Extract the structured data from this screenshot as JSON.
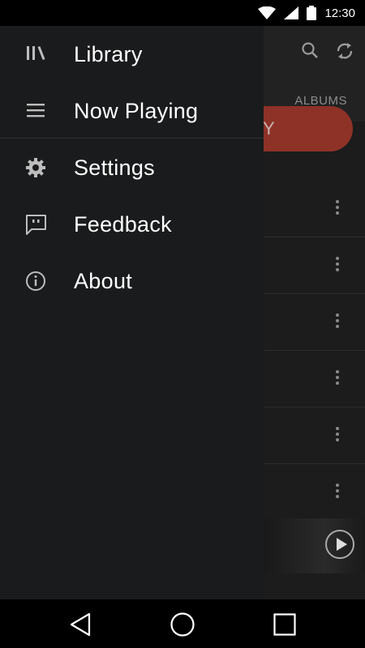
{
  "status_bar": {
    "time": "12:30"
  },
  "background": {
    "tab_label": "ALBUMS",
    "pill_fragment": "Y"
  },
  "drawer": {
    "items": [
      {
        "label": "Library",
        "icon": "library-icon"
      },
      {
        "label": "Now Playing",
        "icon": "menu-lines-icon"
      },
      {
        "label": "Settings",
        "icon": "gear-icon"
      },
      {
        "label": "Feedback",
        "icon": "feedback-icon"
      },
      {
        "label": "About",
        "icon": "info-icon"
      }
    ]
  },
  "colors": {
    "drawer_bg": "#1a1b1c",
    "accent_red": "#8e3228"
  }
}
